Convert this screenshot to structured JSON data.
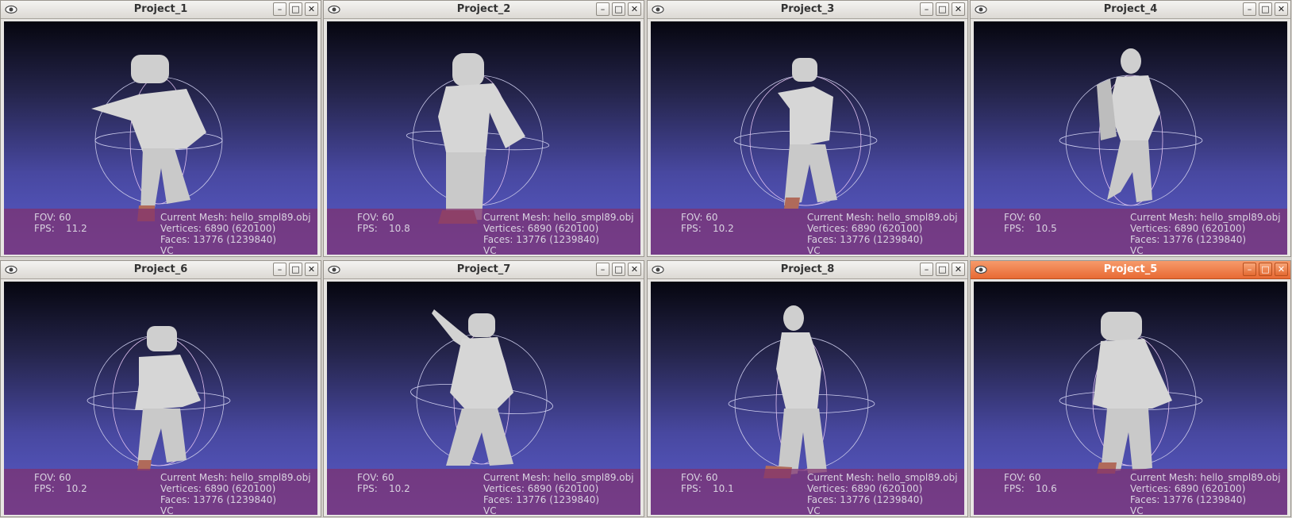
{
  "windows": [
    {
      "title": "Project_1",
      "fov": "FOV: 60",
      "fps_label": "FPS:",
      "fps_value": "11.2",
      "mesh": "Current Mesh: hello_smpl89.obj",
      "vertices": "Vertices: 6890 (620100)",
      "faces": "Faces: 13776 (1239840)",
      "mode": "VC",
      "active": false
    },
    {
      "title": "Project_2",
      "fov": "FOV: 60",
      "fps_label": "FPS:",
      "fps_value": "10.8",
      "mesh": "Current Mesh: hello_smpl89.obj",
      "vertices": "Vertices: 6890 (620100)",
      "faces": "Faces: 13776 (1239840)",
      "mode": "VC",
      "active": false
    },
    {
      "title": "Project_3",
      "fov": "FOV: 60",
      "fps_label": "FPS:",
      "fps_value": "10.2",
      "mesh": "Current Mesh: hello_smpl89.obj",
      "vertices": "Vertices: 6890 (620100)",
      "faces": "Faces: 13776 (1239840)",
      "mode": "VC",
      "active": false
    },
    {
      "title": "Project_4",
      "fov": "FOV: 60",
      "fps_label": "FPS:",
      "fps_value": "10.5",
      "mesh": "Current Mesh: hello_smpl89.obj",
      "vertices": "Vertices: 6890 (620100)",
      "faces": "Faces: 13776 (1239840)",
      "mode": "VC",
      "active": false
    },
    {
      "title": "Project_6",
      "fov": "FOV: 60",
      "fps_label": "FPS:",
      "fps_value": "10.2",
      "mesh": "Current Mesh: hello_smpl89.obj",
      "vertices": "Vertices: 6890 (620100)",
      "faces": "Faces: 13776 (1239840)",
      "mode": "VC",
      "active": false
    },
    {
      "title": "Project_7",
      "fov": "FOV: 60",
      "fps_label": "FPS:",
      "fps_value": "10.2",
      "mesh": "Current Mesh: hello_smpl89.obj",
      "vertices": "Vertices: 6890 (620100)",
      "faces": "Faces: 13776 (1239840)",
      "mode": "VC",
      "active": false
    },
    {
      "title": "Project_8",
      "fov": "FOV: 60",
      "fps_label": "FPS:",
      "fps_value": "10.1",
      "mesh": "Current Mesh: hello_smpl89.obj",
      "vertices": "Vertices: 6890 (620100)",
      "faces": "Faces: 13776 (1239840)",
      "mode": "VC",
      "active": false
    },
    {
      "title": "Project_5",
      "fov": "FOV: 60",
      "fps_label": "FPS:",
      "fps_value": "10.6",
      "mesh": "Current Mesh: hello_smpl89.obj",
      "vertices": "Vertices: 6890 (620100)",
      "faces": "Faces: 13776 (1239840)",
      "mode": "VC",
      "active": true
    }
  ],
  "titlebar_buttons": {
    "minimize": "–",
    "maximize": "□",
    "close": "✕"
  },
  "icons": {
    "app": "eye-icon",
    "minimize": "minimize-icon",
    "maximize": "maximize-icon",
    "close": "close-icon"
  },
  "colors": {
    "active_titlebar": "#e86a34",
    "info_overlay": "#80306e",
    "viewport_top": "#06060f",
    "viewport_bottom": "#5a5ccc",
    "mesh": "#d9d9d9",
    "trackball": "#c8c8e8"
  }
}
